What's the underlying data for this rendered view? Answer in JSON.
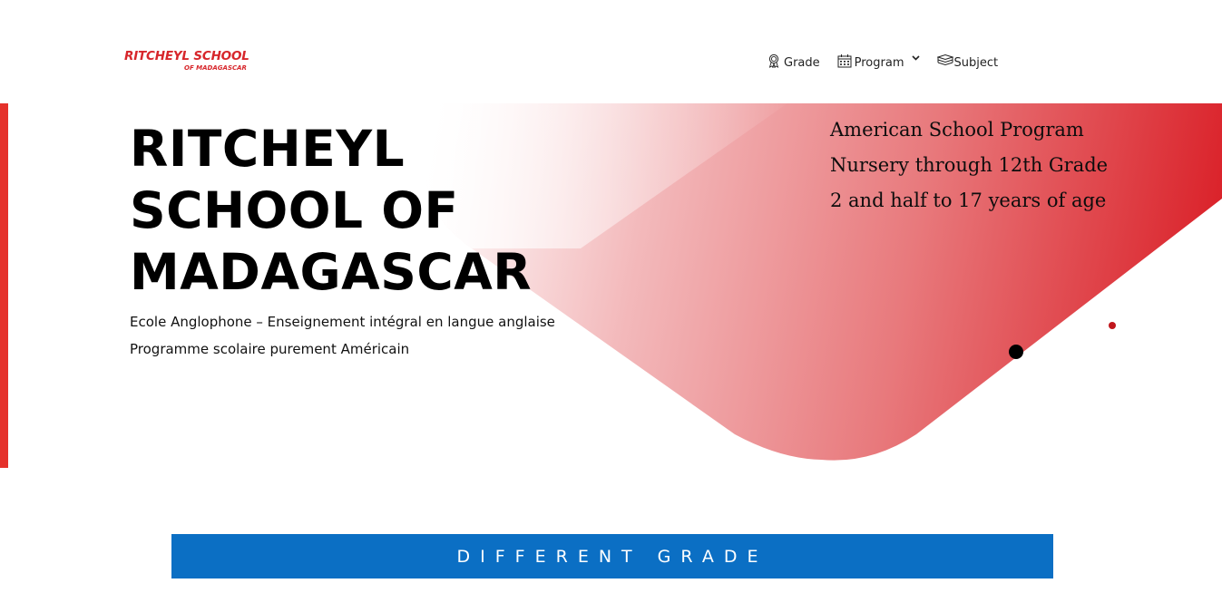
{
  "header": {
    "logo": {
      "line1": "RITCHEYL SCHOOL",
      "line2": "OF MADAGASCAR"
    },
    "nav": [
      {
        "label": "Grade",
        "icon": "award-ribbon-icon"
      },
      {
        "label": "Program",
        "icon": "calendar-icon",
        "has_dropdown": true
      },
      {
        "label": "Subject",
        "icon": "books-icon"
      }
    ]
  },
  "hero": {
    "title_lines": [
      "RITCHEYL",
      "SCHOOL OF",
      "MADAGASCAR"
    ],
    "subtitle_lines": [
      "Ecole Anglophone – Enseignement intégral en langue anglaise",
      "Programme scolaire purement Américain"
    ],
    "info_lines": [
      "American School Program",
      "Nursery through 12th Grade",
      "2 and half to 17 years of age"
    ]
  },
  "section": {
    "banner_title": "DIFFERENT GRADE"
  },
  "colors": {
    "brand_red": "#d7262b",
    "accent_red": "#e5312b",
    "banner_blue": "#0b6fc4"
  }
}
